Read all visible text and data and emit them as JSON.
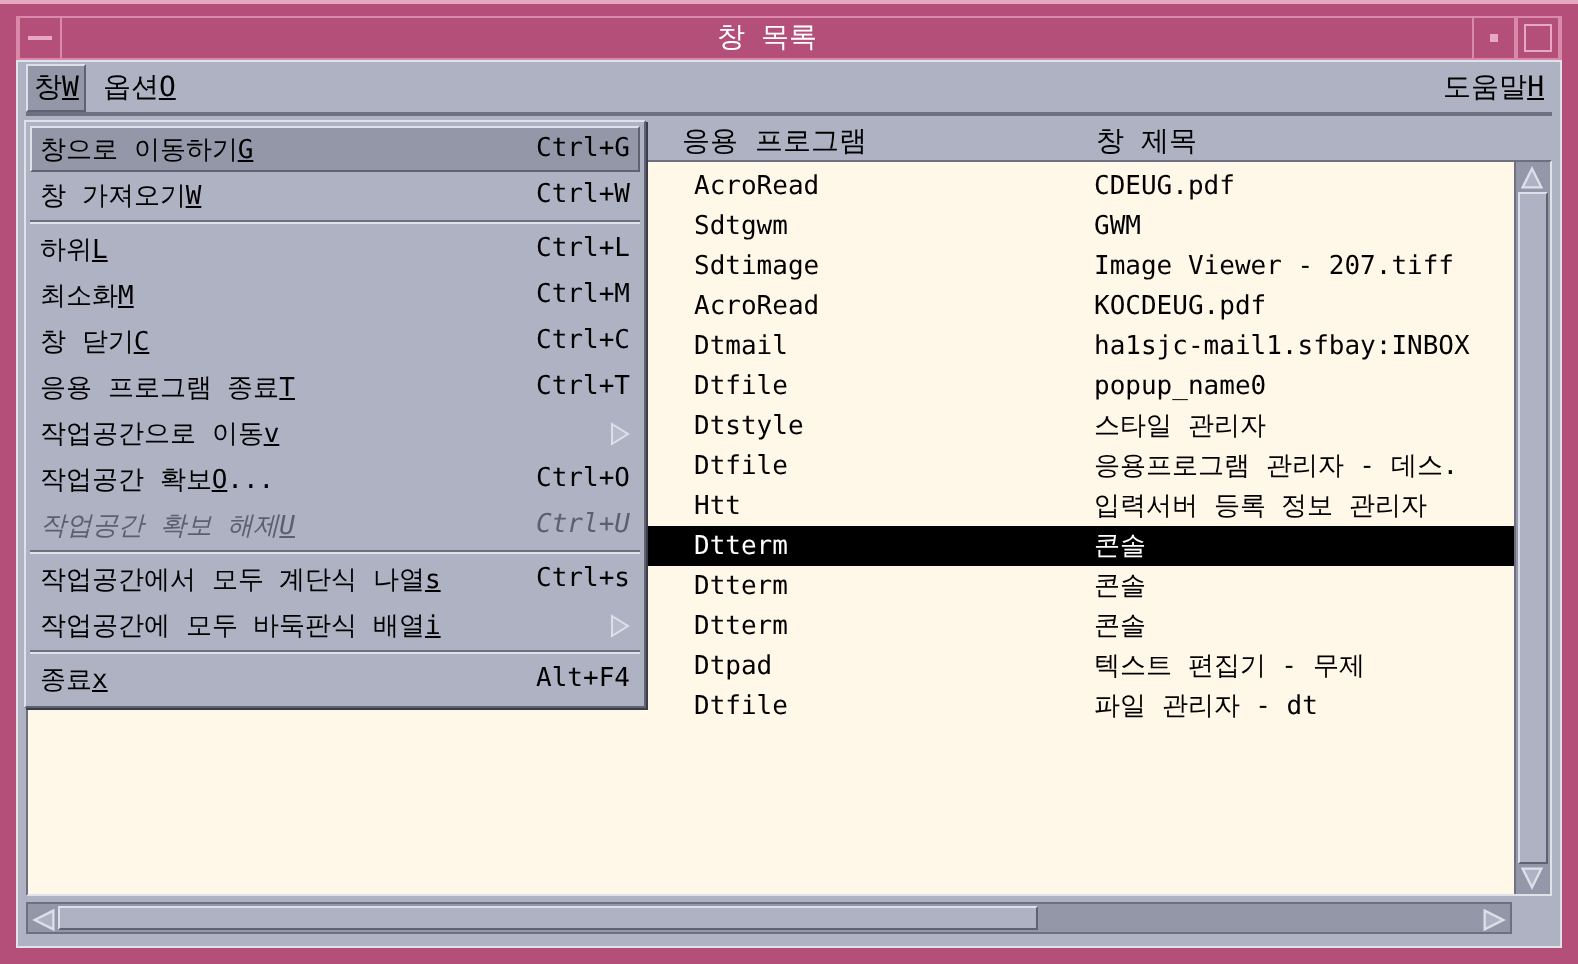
{
  "window": {
    "title": "창 목록"
  },
  "menubar": [
    {
      "label": "창",
      "mnemonic": "W",
      "selected": true
    },
    {
      "label": "옵션",
      "mnemonic": "O",
      "selected": false
    }
  ],
  "help_menu": {
    "label": "도움말",
    "mnemonic": "H"
  },
  "open_menu": [
    {
      "kind": "item",
      "label": "창으로 이동하기",
      "mnemonic": "G",
      "shortcut": "Ctrl+G",
      "selected": true,
      "disabled": false
    },
    {
      "kind": "item",
      "label": "창 가져오기",
      "mnemonic": "W",
      "shortcut": "Ctrl+W",
      "selected": false,
      "disabled": false
    },
    {
      "kind": "separator"
    },
    {
      "kind": "item",
      "label": "하위",
      "mnemonic": "L",
      "shortcut": "Ctrl+L",
      "selected": false,
      "disabled": false
    },
    {
      "kind": "item",
      "label": "최소화",
      "mnemonic": "M",
      "shortcut": "Ctrl+M",
      "selected": false,
      "disabled": false
    },
    {
      "kind": "item",
      "label": "창 닫기",
      "mnemonic": "C",
      "shortcut": "Ctrl+C",
      "selected": false,
      "disabled": false
    },
    {
      "kind": "item",
      "label": "응용 프로그램 종료",
      "mnemonic": "T",
      "shortcut": "Ctrl+T",
      "selected": false,
      "disabled": false
    },
    {
      "kind": "submenu",
      "label": "작업공간으로 이동",
      "mnemonic": "v",
      "selected": false,
      "disabled": false
    },
    {
      "kind": "item",
      "label": "작업공간 확보",
      "mnemonic": "O",
      "suffix": "...",
      "shortcut": "Ctrl+O",
      "selected": false,
      "disabled": false
    },
    {
      "kind": "item",
      "label": "작업공간 확보 해제",
      "mnemonic": "U",
      "shortcut": "Ctrl+U",
      "selected": false,
      "disabled": true
    },
    {
      "kind": "separator"
    },
    {
      "kind": "item",
      "label": "작업공간에서 모두 계단식 나열",
      "mnemonic": "s",
      "shortcut": "Ctrl+s",
      "selected": false,
      "disabled": false
    },
    {
      "kind": "submenu",
      "label": "작업공간에 모두 바둑판식 배열",
      "mnemonic": "i",
      "selected": false,
      "disabled": false
    },
    {
      "kind": "separator"
    },
    {
      "kind": "item",
      "label": "종료",
      "mnemonic": "x",
      "shortcut": "Alt+F4",
      "selected": false,
      "disabled": false
    }
  ],
  "table": {
    "columns": [
      "응용 프로그램",
      "창 제목"
    ],
    "rows": [
      {
        "application": "AcroRead",
        "title": "CDEUG.pdf",
        "selected": false
      },
      {
        "application": "Sdtgwm",
        "title": "GWM",
        "selected": false
      },
      {
        "application": "Sdtimage",
        "title": "Image Viewer - 207.tiff",
        "selected": false
      },
      {
        "application": "AcroRead",
        "title": "KOCDEUG.pdf",
        "selected": false
      },
      {
        "application": "Dtmail",
        "title": "ha1sjc-mail1.sfbay:INBOX",
        "selected": false
      },
      {
        "application": "Dtfile",
        "title": "popup_name0",
        "selected": false
      },
      {
        "application": "Dtstyle",
        "title": "스타일 관리자",
        "selected": false
      },
      {
        "application": "Dtfile",
        "title": "응용프로그램 관리자 - 데스.",
        "selected": false
      },
      {
        "application": "Htt",
        "title": "입력서버 등록 정보 관리자",
        "selected": false
      },
      {
        "application": "Dtterm",
        "title": "콘솔",
        "selected": true
      },
      {
        "application": "Dtterm",
        "title": "콘솔",
        "selected": false
      },
      {
        "application": "Dtterm",
        "title": "콘솔",
        "selected": false
      },
      {
        "application": "Dtpad",
        "title": "텍스트 편집기 - 무제",
        "selected": false
      },
      {
        "application": "Dtfile",
        "title": "파일 관리자 - dt",
        "selected": false
      }
    ]
  }
}
